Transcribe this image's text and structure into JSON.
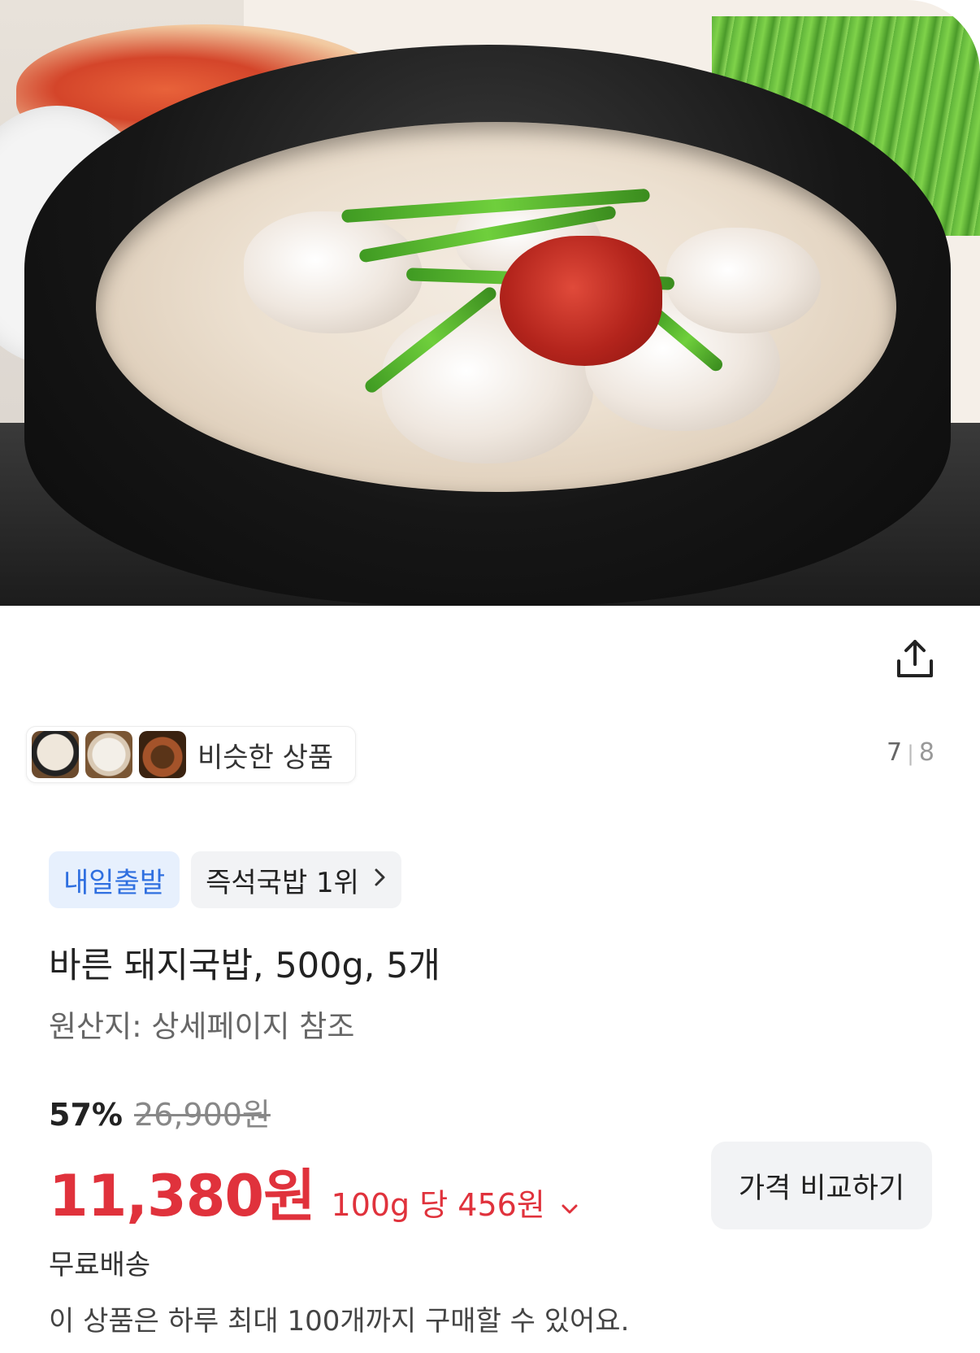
{
  "product": {
    "title": "바른 돼지국밥, 500g, 5개",
    "origin": "원산지: 상세페이지 참조"
  },
  "gallery": {
    "current": "7",
    "total": "8"
  },
  "similar": {
    "label": "비슷한 상품"
  },
  "badges": {
    "delivery": "내일출발",
    "rank": "즉석국밥 1위"
  },
  "pricing": {
    "discount": "57%",
    "original_price": "26,900원",
    "sale_price": "11,380원",
    "unit_price": "100g 당 456원",
    "compare_button": "가격 비교하기",
    "accent_color": "#e0323c"
  },
  "shipping": {
    "label": "무료배송",
    "limit_notice": "이 상품은 하루 최대 100개까지 구매할 수 있어요."
  },
  "icons": {
    "share": "share-icon",
    "rank_chevron": "chevron-right-icon",
    "unit_chevron": "chevron-down-icon"
  }
}
